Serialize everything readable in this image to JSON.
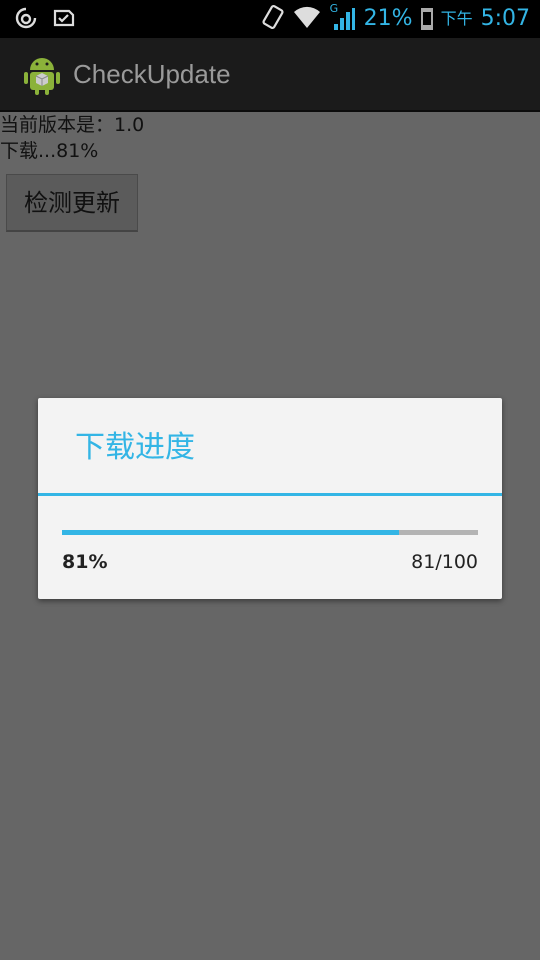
{
  "status_bar": {
    "icons_left": [
      "weibo-icon",
      "message-check-icon"
    ],
    "network_label": "G",
    "battery_percent": "21%",
    "battery_level": 0.21,
    "ampm": "下午",
    "time": "5:07"
  },
  "action_bar": {
    "title": "CheckUpdate"
  },
  "content": {
    "version_line": "当前版本是：1.0",
    "download_line": "下载...81%",
    "check_button_label": "检测更新"
  },
  "dialog": {
    "title": "下载进度",
    "progress_fraction": 0.81,
    "percent_label": "81%",
    "count_label": "81/100"
  },
  "colors": {
    "accent": "#33b5e5",
    "background": "#666666"
  }
}
